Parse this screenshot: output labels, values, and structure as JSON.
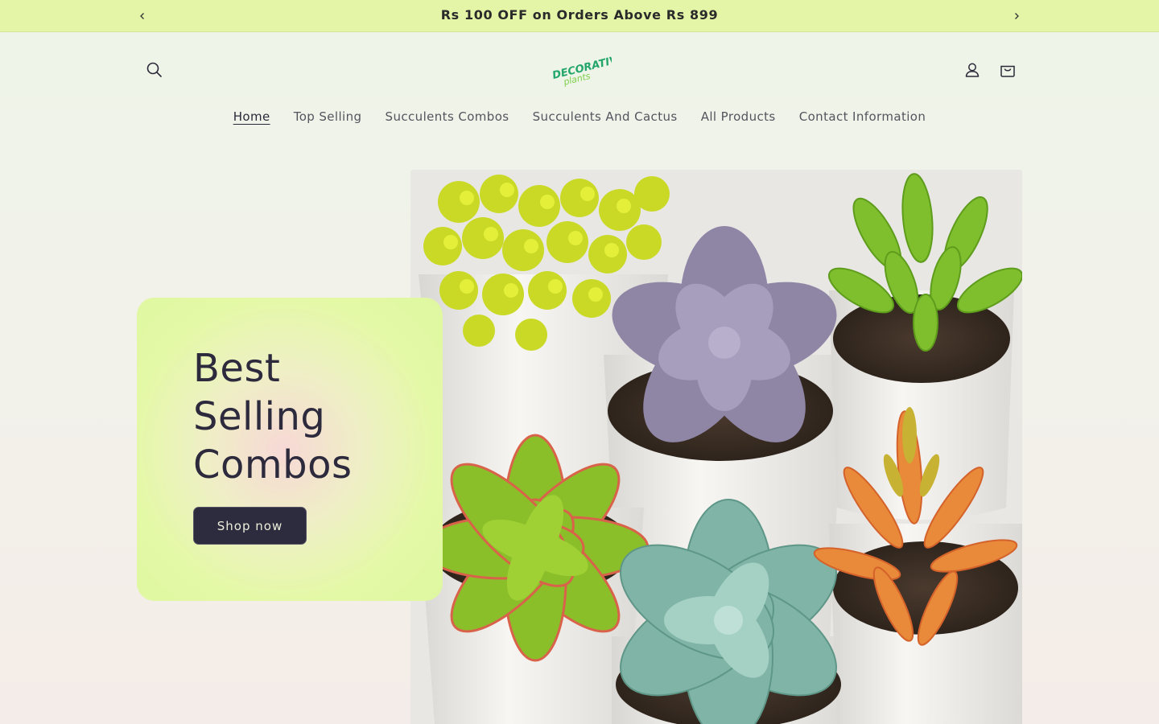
{
  "announcement": {
    "text": "Rs 100 OFF on Orders Above Rs 899",
    "prev_icon": "chevron-left-icon",
    "next_icon": "chevron-right-icon"
  },
  "header": {
    "search_icon": "search-icon",
    "account_icon": "user-icon",
    "cart_icon": "bag-icon",
    "logo_text_top": "DECORATIVE",
    "logo_text_bottom": "plants"
  },
  "nav": {
    "items": [
      {
        "label": "Home",
        "active": true
      },
      {
        "label": "Top Selling"
      },
      {
        "label": "Succulents Combos"
      },
      {
        "label": "Succulents And Cactus"
      },
      {
        "label": "All Products"
      },
      {
        "label": "Contact Information"
      }
    ]
  },
  "hero": {
    "title_line1": "Best",
    "title_line2": "Selling",
    "title_line3": "Combos",
    "button_label": "Shop now"
  },
  "colors": {
    "announcement_bg": "#e4f5a8",
    "button_bg": "#2d2b3e",
    "accent_green": "#2bb673"
  }
}
